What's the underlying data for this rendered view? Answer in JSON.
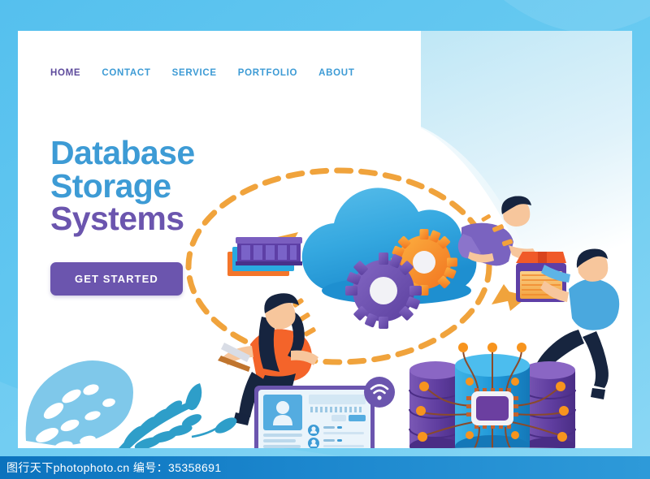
{
  "page": {
    "frame_color": "#5ec3ef",
    "card_background": "#ffffff"
  },
  "nav": {
    "items": [
      {
        "label": "HOME",
        "active": true,
        "color": "#5d4a9c"
      },
      {
        "label": "CONTACT",
        "active": false,
        "color": "#3d9bd5"
      },
      {
        "label": "SERVICE",
        "active": false,
        "color": "#3d9bd5"
      },
      {
        "label": "PORTFOLIO",
        "active": false,
        "color": "#3d9bd5"
      },
      {
        "label": "ABOUT",
        "active": false,
        "color": "#3d9bd5"
      }
    ]
  },
  "hero": {
    "line1": "Database",
    "line2": "Storage",
    "line3": "Systems",
    "line1_color": "#3d9bd5",
    "line3_color": "#6b55ae",
    "cta_label": "GET STARTED",
    "cta_color": "#6b55ae"
  },
  "illustration": {
    "cloud": {
      "name": "cloud-with-gears",
      "cloud_color": "#35aae2",
      "gear_purple": "#6b4fae",
      "gear_orange": "#f7941e"
    },
    "ram_module": {
      "name": "ram-memory-stick",
      "color": "#5e3fa6"
    },
    "database_stack": {
      "name": "database-cylinders",
      "color": "#6b3fa0"
    },
    "cpu_cylinder": {
      "name": "cpu-chip-cylinder",
      "color": "#2aa9e0",
      "chip_color": "#6b3fa0"
    },
    "laptop": {
      "name": "laptop-user-profile",
      "screen_color": "#eaf4fb"
    },
    "wifi_badge": {
      "name": "wifi-icon-badge",
      "color": "#6b55ae"
    },
    "dashed_orbit": {
      "name": "dashed-flow-orbit",
      "color": "#f0a33c"
    },
    "people": [
      {
        "name": "woman-with-laptop",
        "shirt_color": "#f4642a",
        "hair_color": "#16243f"
      },
      {
        "name": "man-purple-shirt",
        "shirt_color": "#7a63c0",
        "hair_color": "#16243f"
      },
      {
        "name": "man-blue-shirt",
        "shirt_color": "#4aa8de",
        "hair_color": "#16243f"
      }
    ],
    "server_box": {
      "name": "server-storage-box",
      "top_color": "#f05a28",
      "body_color": "#f7b955"
    },
    "leaves": {
      "name": "tropical-leaves-decoration",
      "monstera_color": "#7fc8ea",
      "fern_color": "#2e9ec9"
    }
  },
  "watermark": {
    "text": "图行天下photophoto.cn  编号：35358691"
  }
}
